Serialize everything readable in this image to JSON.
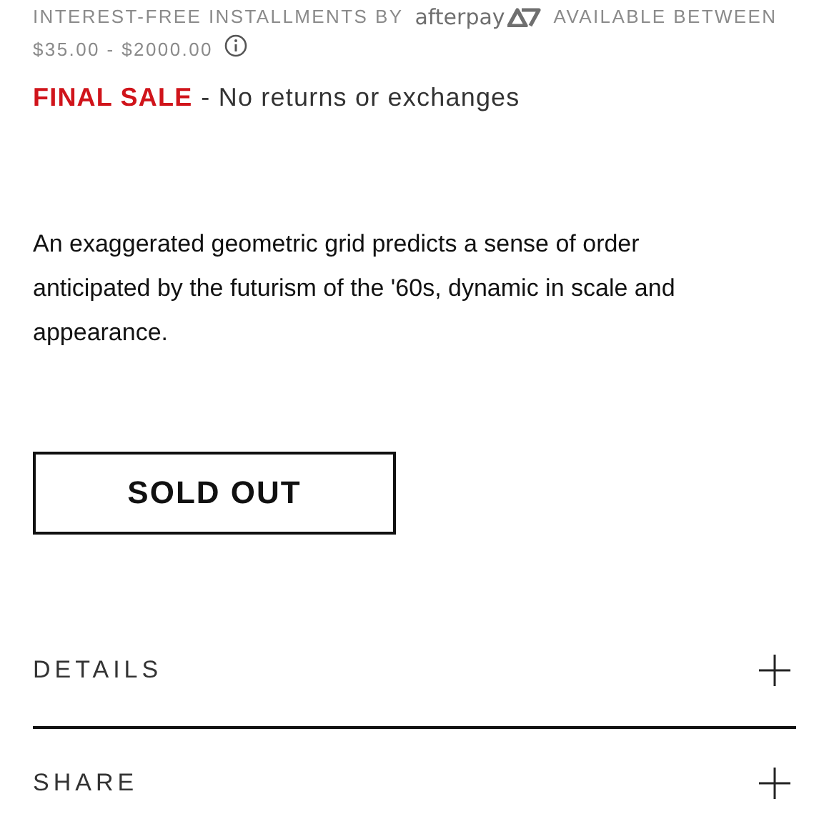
{
  "installments": {
    "prefix": "INTEREST-FREE INSTALLMENTS BY",
    "brand": "afterpay",
    "suffix": "AVAILABLE BETWEEN",
    "range": "$35.00 - $2000.00"
  },
  "final_sale": {
    "label": "FINAL SALE",
    "note": "- No returns or exchanges"
  },
  "description": "An exaggerated geometric grid predicts a sense of order anticipated by the futurism of the '60s, dynamic in scale and appearance.",
  "button": {
    "label": "SOLD OUT",
    "disabled": true
  },
  "sections": [
    {
      "label": "DETAILS",
      "expanded": false
    },
    {
      "label": "SHARE",
      "expanded": false
    }
  ]
}
